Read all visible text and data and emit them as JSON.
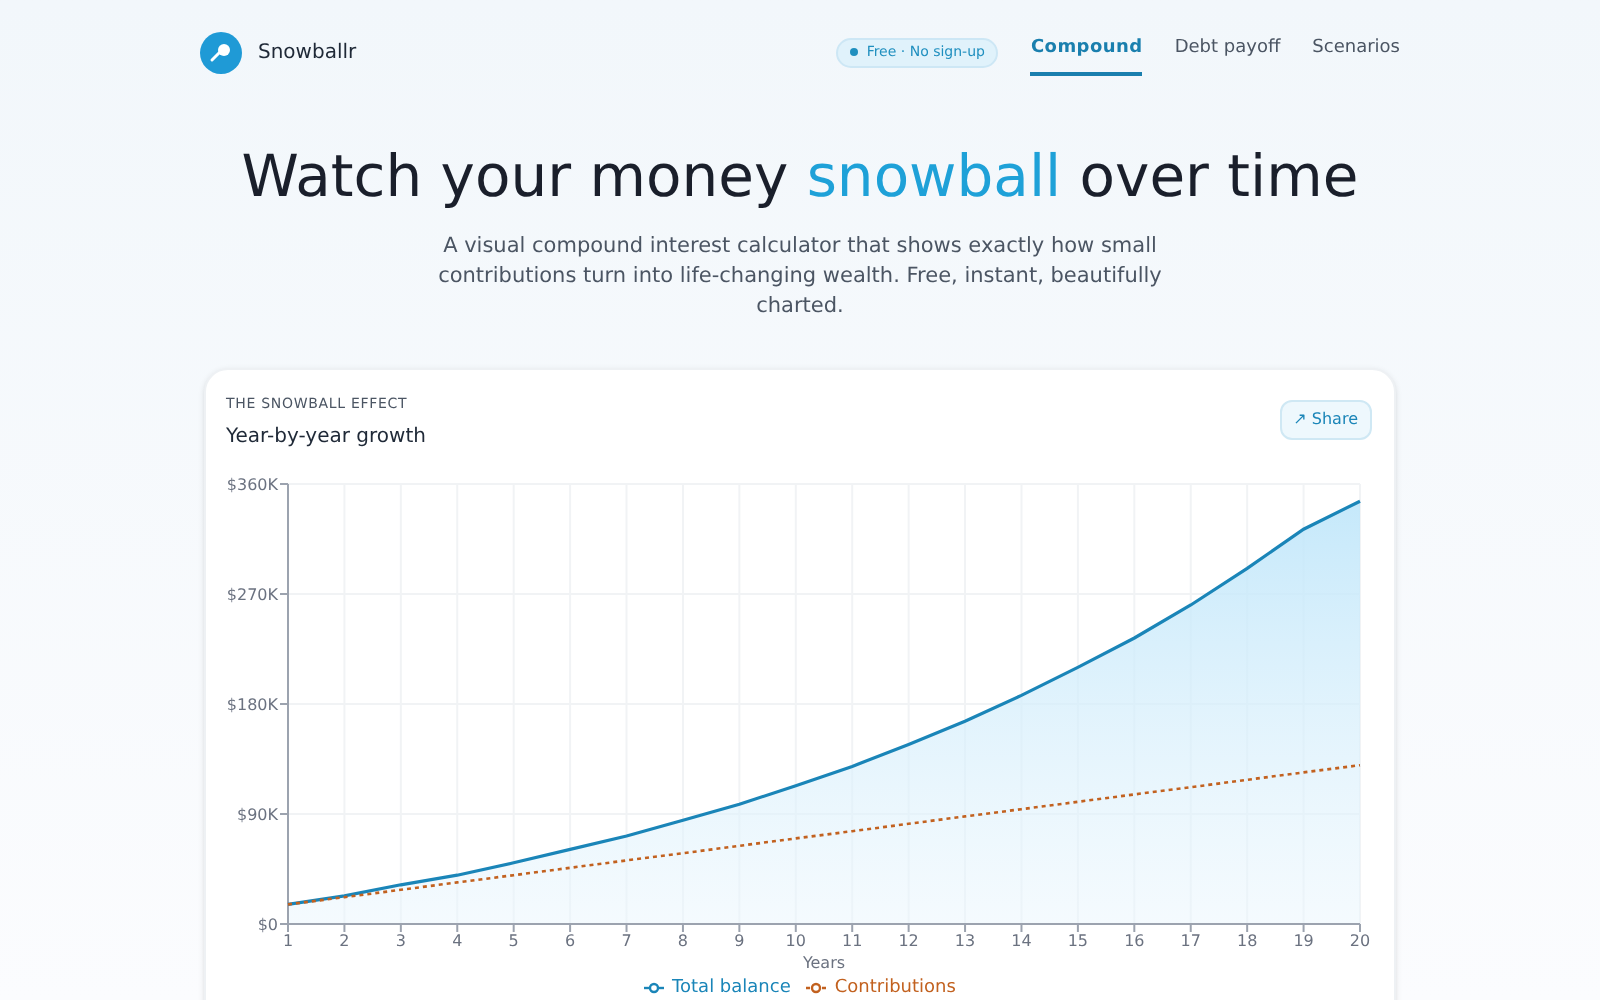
{
  "brand": {
    "name": "Snowballr"
  },
  "badge": "Free · No sign-up",
  "nav": [
    {
      "label": "Compound",
      "selected": true
    },
    {
      "label": "Debt payoff",
      "selected": false
    },
    {
      "label": "Scenarios",
      "selected": false
    }
  ],
  "hero": {
    "title_before": "Watch your money ",
    "title_highlight": "snowball",
    "title_after": " over time",
    "subtitle": "A visual compound interest calculator that shows exactly how small contributions turn into life-changing wealth. Free, instant, beautifully charted."
  },
  "card": {
    "eyebrow": "THE SNOWBALL EFFECT",
    "title": "Year-by-year growth",
    "share_button": "↗ Share",
    "chart_data": {
      "type": "area",
      "xlabel": "Years",
      "x": [
        1,
        2,
        3,
        4,
        5,
        6,
        7,
        8,
        9,
        10,
        11,
        12,
        13,
        14,
        15,
        16,
        17,
        18,
        19,
        20
      ],
      "xlim": [
        1,
        20
      ],
      "grid": true,
      "legend": true,
      "ylim": [
        0,
        360000
      ],
      "yticks": [
        {
          "value": 0,
          "label": "$0"
        },
        {
          "value": 90000,
          "label": "$90K"
        },
        {
          "value": 180000,
          "label": "$180K"
        },
        {
          "value": 270000,
          "label": "$270K"
        },
        {
          "value": 360000,
          "label": "$360K"
        }
      ],
      "xticks": [
        1,
        2,
        3,
        4,
        5,
        6,
        7,
        8,
        9,
        10,
        11,
        12,
        13,
        14,
        15,
        16,
        17,
        18,
        19,
        20
      ],
      "series": [
        {
          "name": "Total balance",
          "type": "area",
          "line_style": "solid",
          "color": "#1a85b8",
          "values": [
            16000,
            23000,
            32000,
            40000,
            50000,
            61000,
            72000,
            85000,
            98000,
            113000,
            129000,
            147000,
            166000,
            187000,
            210000,
            234000,
            261000,
            291000,
            323000,
            346000
          ]
        },
        {
          "name": "Contributions",
          "type": "line",
          "line_style": "dashed",
          "color": "#c2611f",
          "values": [
            16000,
            22000,
            28000,
            34000,
            40000,
            46000,
            52000,
            58000,
            64000,
            70000,
            76000,
            82000,
            88000,
            94000,
            100000,
            106000,
            112000,
            118000,
            124000,
            130000
          ]
        }
      ]
    }
  }
}
